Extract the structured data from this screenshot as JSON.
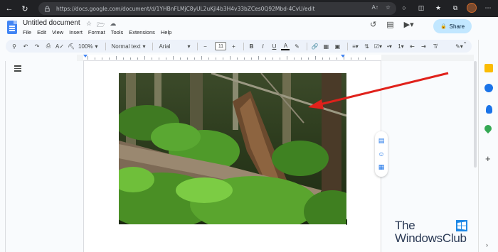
{
  "browser": {
    "url": "https://docs.google.com/document/d/1YHBnFLMjC8yUL2uKjl4b3H4v33bZCes0Q92Mbd-4CvU/edit",
    "nav_icons": [
      "back-icon",
      "refresh-icon"
    ]
  },
  "docs": {
    "title": "Untitled document",
    "menu": [
      "File",
      "Edit",
      "View",
      "Insert",
      "Format",
      "Tools",
      "Extensions",
      "Help"
    ],
    "share_label": "Share"
  },
  "toolbar": {
    "zoom": "100%",
    "style": "Normal text",
    "font": "Arial",
    "font_size": "11"
  },
  "watermark": {
    "line1": "The",
    "line2": "WindowsClub"
  },
  "colors": {
    "accent": "#1a73e8",
    "share_bg": "#c2e7ff",
    "arrow": "#e0211b",
    "browser_bar": "#202124"
  }
}
